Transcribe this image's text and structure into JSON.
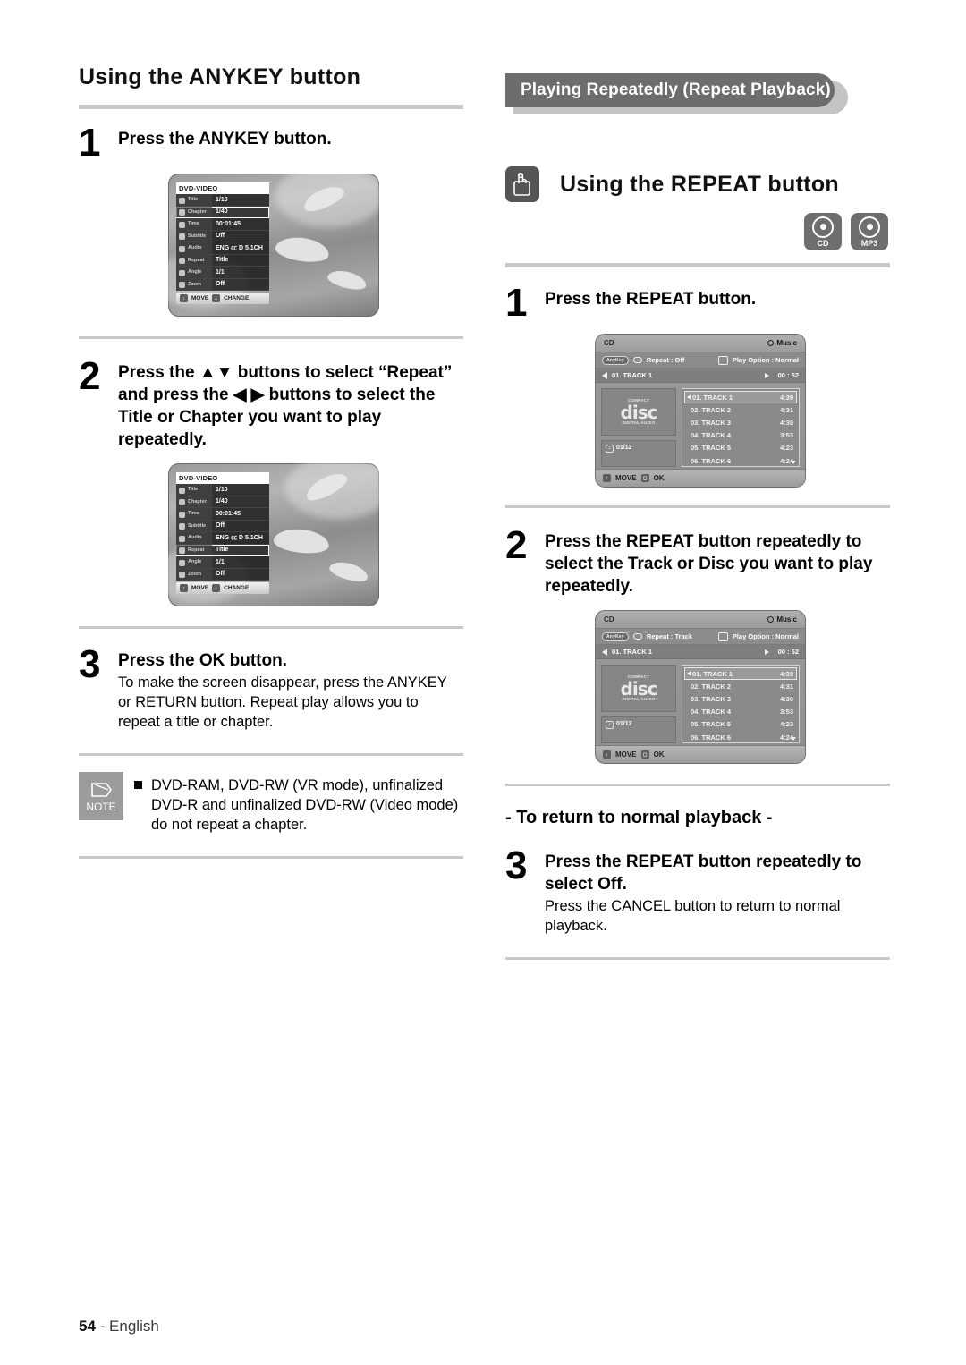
{
  "left": {
    "section_title": "Using the ANYKEY button",
    "steps": [
      {
        "num": "1",
        "title": "Press the ANYKEY button.",
        "desc": ""
      },
      {
        "num": "2",
        "title": "Press the ▲▼ buttons to select “Repeat” and press the ◀ ▶ buttons to select the Title or Chapter you want to play repeatedly.",
        "desc": ""
      },
      {
        "num": "3",
        "title": "Press the OK button.",
        "desc": "To make the screen disappear, press the ANYKEY or RETURN button. Repeat play allows you to repeat a title or chapter."
      }
    ],
    "note": {
      "label": "NOTE",
      "line1": "DVD-RAM, DVD-RW (VR mode), unfinalized",
      "line2": "DVD-R and unfinalized DVD-RW (Video mode)",
      "line3": "do not repeat a chapter."
    }
  },
  "dvd_osd": {
    "header": "DVD-VIDEO",
    "rows": [
      {
        "key": "Title",
        "value": "1/10"
      },
      {
        "key": "Chapter",
        "value": "1/40"
      },
      {
        "key": "Time",
        "value": "00:01:45"
      },
      {
        "key": "Subtitle",
        "value": "Off"
      },
      {
        "key": "Audio",
        "value": "ENG ㏄ D  5.1CH"
      },
      {
        "key": "Repeat",
        "value": "Title"
      },
      {
        "key": "Angle",
        "value": "1/1"
      },
      {
        "key": "Zoom",
        "value": "Off"
      }
    ],
    "bar": {
      "move": "MOVE",
      "change": "CHANGE"
    },
    "selected_first": "Chapter",
    "selected_second": "Repeat"
  },
  "right": {
    "banner": "Playing Repeatedly (Repeat Playback)",
    "sub_title": "Using the REPEAT button",
    "badges": [
      {
        "label": "CD"
      },
      {
        "label": "MP3"
      }
    ],
    "steps": [
      {
        "num": "1",
        "title": "Press the REPEAT button.",
        "desc": ""
      },
      {
        "num": "2",
        "title": "Press the REPEAT button repeatedly to select the Track or Disc you want to play repeatedly.",
        "desc": ""
      },
      {
        "num": "3",
        "title": "Press the REPEAT button repeatedly to select Off.",
        "desc": "Press the CANCEL button to return to normal playback."
      }
    ],
    "return_heading": "- To return to normal playback -"
  },
  "cd_osd": {
    "disc_label": "CD",
    "mode_label": "Music",
    "anykey_pill": "AnyKey",
    "repeat_off": "Repeat : Off",
    "repeat_track": "Repeat : Track",
    "play_option": "Play Option : Normal",
    "now_playing": "01. TRACK 1",
    "elapsed": "00 : 52",
    "disc_logo_top": "COMPACT",
    "disc_logo_main": "disc",
    "disc_logo_bottom": "DIGITAL AUDIO",
    "track_counter": "01/12",
    "tracks": [
      {
        "name": "01. TRACK 1",
        "time": "4:39"
      },
      {
        "name": "02. TRACK 2",
        "time": "4:31"
      },
      {
        "name": "03. TRACK 3",
        "time": "4:30"
      },
      {
        "name": "04. TRACK 4",
        "time": "3:53"
      },
      {
        "name": "05. TRACK 5",
        "time": "4:23"
      },
      {
        "name": "06. TRACK 6",
        "time": "4:24"
      }
    ],
    "bottom": {
      "move": "MOVE",
      "ok": "OK"
    }
  },
  "footer": {
    "page": "54",
    "language": "- English"
  }
}
